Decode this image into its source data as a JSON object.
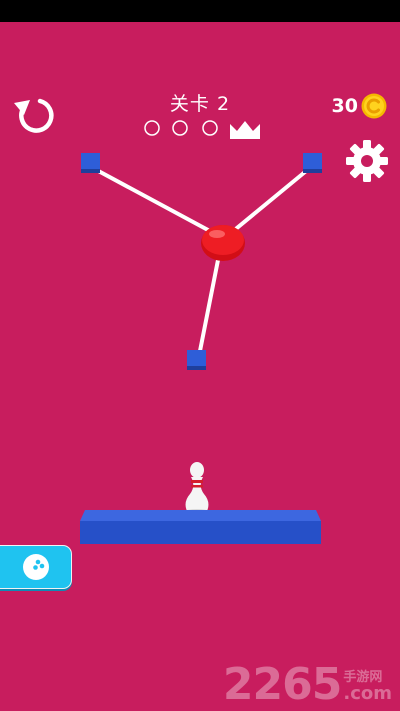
{
  "hud": {
    "level_label": "关卡 2",
    "stars_total": 3,
    "stars_filled": 0,
    "coins": "30"
  },
  "icons": {
    "restart": "restart-icon",
    "settings": "gear-icon",
    "coin": "coin-icon",
    "crown": "crown-icon",
    "ball_button": "bowling-ball-icon"
  },
  "scene": {
    "anchors": 3,
    "ball_color": "#E8141E",
    "anchor_color": "#2D5BD6",
    "platform_color": "#2D55C8",
    "pin_color": "#F4F4F4",
    "background": "#C81D5E"
  },
  "watermark": {
    "digits": "2265",
    "cn": "手游网",
    "domain": ".com"
  }
}
